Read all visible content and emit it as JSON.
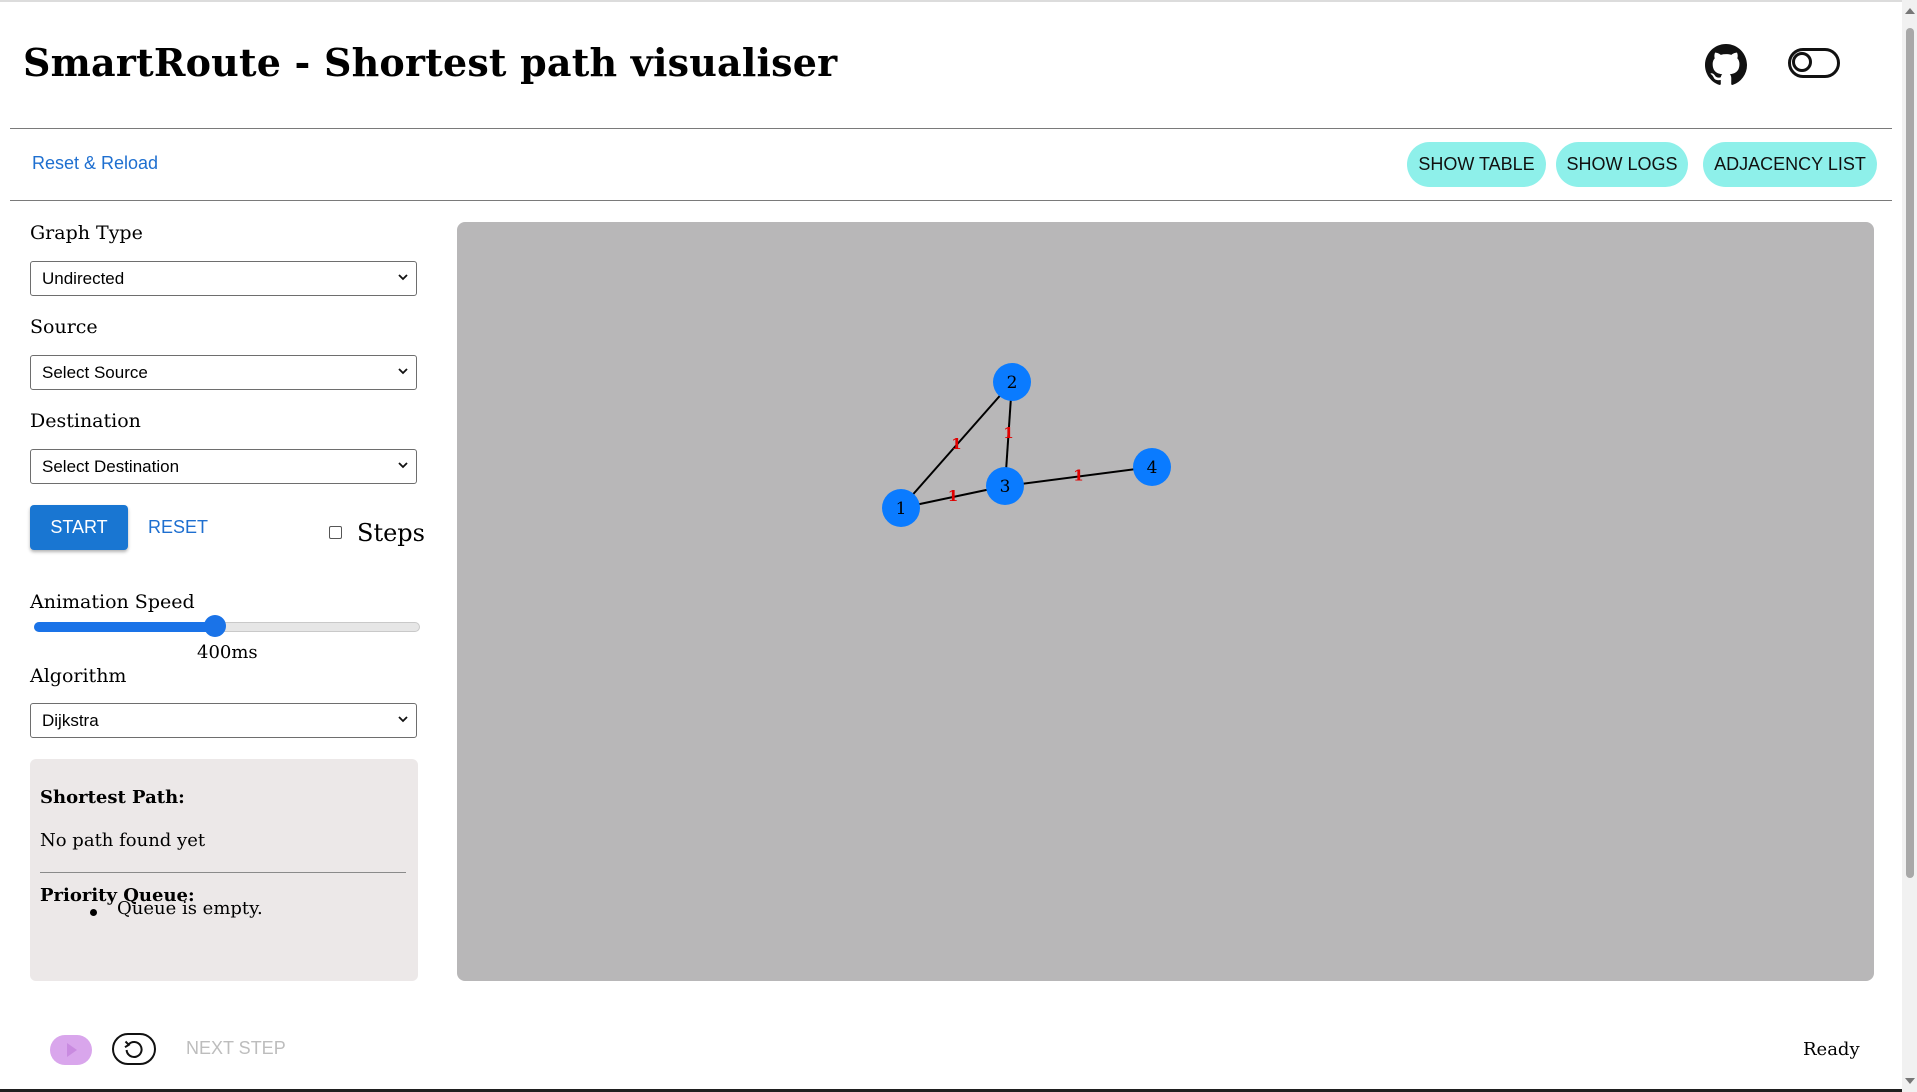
{
  "header": {
    "title": "SmartRoute - Shortest path visualiser",
    "github_icon": "github-icon",
    "theme_toggle_icon": "toggle-icon"
  },
  "toolbar": {
    "reset_reload": "Reset & Reload",
    "show_table": "SHOW TABLE",
    "show_logs": "SHOW LOGS",
    "adjacency_list": "ADJACENCY LIST"
  },
  "sidebar": {
    "graph_type_label": "Graph Type",
    "graph_type_value": "Undirected",
    "source_label": "Source",
    "source_value": "Select Source",
    "destination_label": "Destination",
    "destination_value": "Select Destination",
    "start_label": "START",
    "reset_label": "RESET",
    "steps_label": "Steps",
    "steps_checked": false,
    "animation_speed_label": "Animation Speed",
    "animation_speed_value": "400ms",
    "animation_speed_fraction": 0.47,
    "algorithm_label": "Algorithm",
    "algorithm_value": "Dijkstra"
  },
  "info": {
    "shortest_path_heading": "Shortest Path:",
    "shortest_path_text": "No path found yet",
    "priority_queue_heading": "Priority Queue:",
    "queue_items": [
      "Queue is empty."
    ]
  },
  "graph": {
    "background": "#b8b7b8",
    "node_color": "#0a7bff",
    "weight_color": "#e00000",
    "nodes": [
      {
        "id": "1",
        "label": "1"
      },
      {
        "id": "2",
        "label": "2"
      },
      {
        "id": "3",
        "label": "3"
      },
      {
        "id": "4",
        "label": "4"
      }
    ],
    "edges": [
      {
        "from": "1",
        "to": "2",
        "weight": "1"
      },
      {
        "from": "2",
        "to": "3",
        "weight": "1"
      },
      {
        "from": "1",
        "to": "3",
        "weight": "1"
      },
      {
        "from": "3",
        "to": "4",
        "weight": "1"
      }
    ]
  },
  "footer": {
    "play_icon": "play-icon",
    "replay_icon": "replay-icon",
    "next_step": "NEXT STEP",
    "status": "Ready"
  },
  "colors": {
    "accent": "#1976d2",
    "pill": "#8ef0ea",
    "play_disabled": "#d9a6ec"
  }
}
